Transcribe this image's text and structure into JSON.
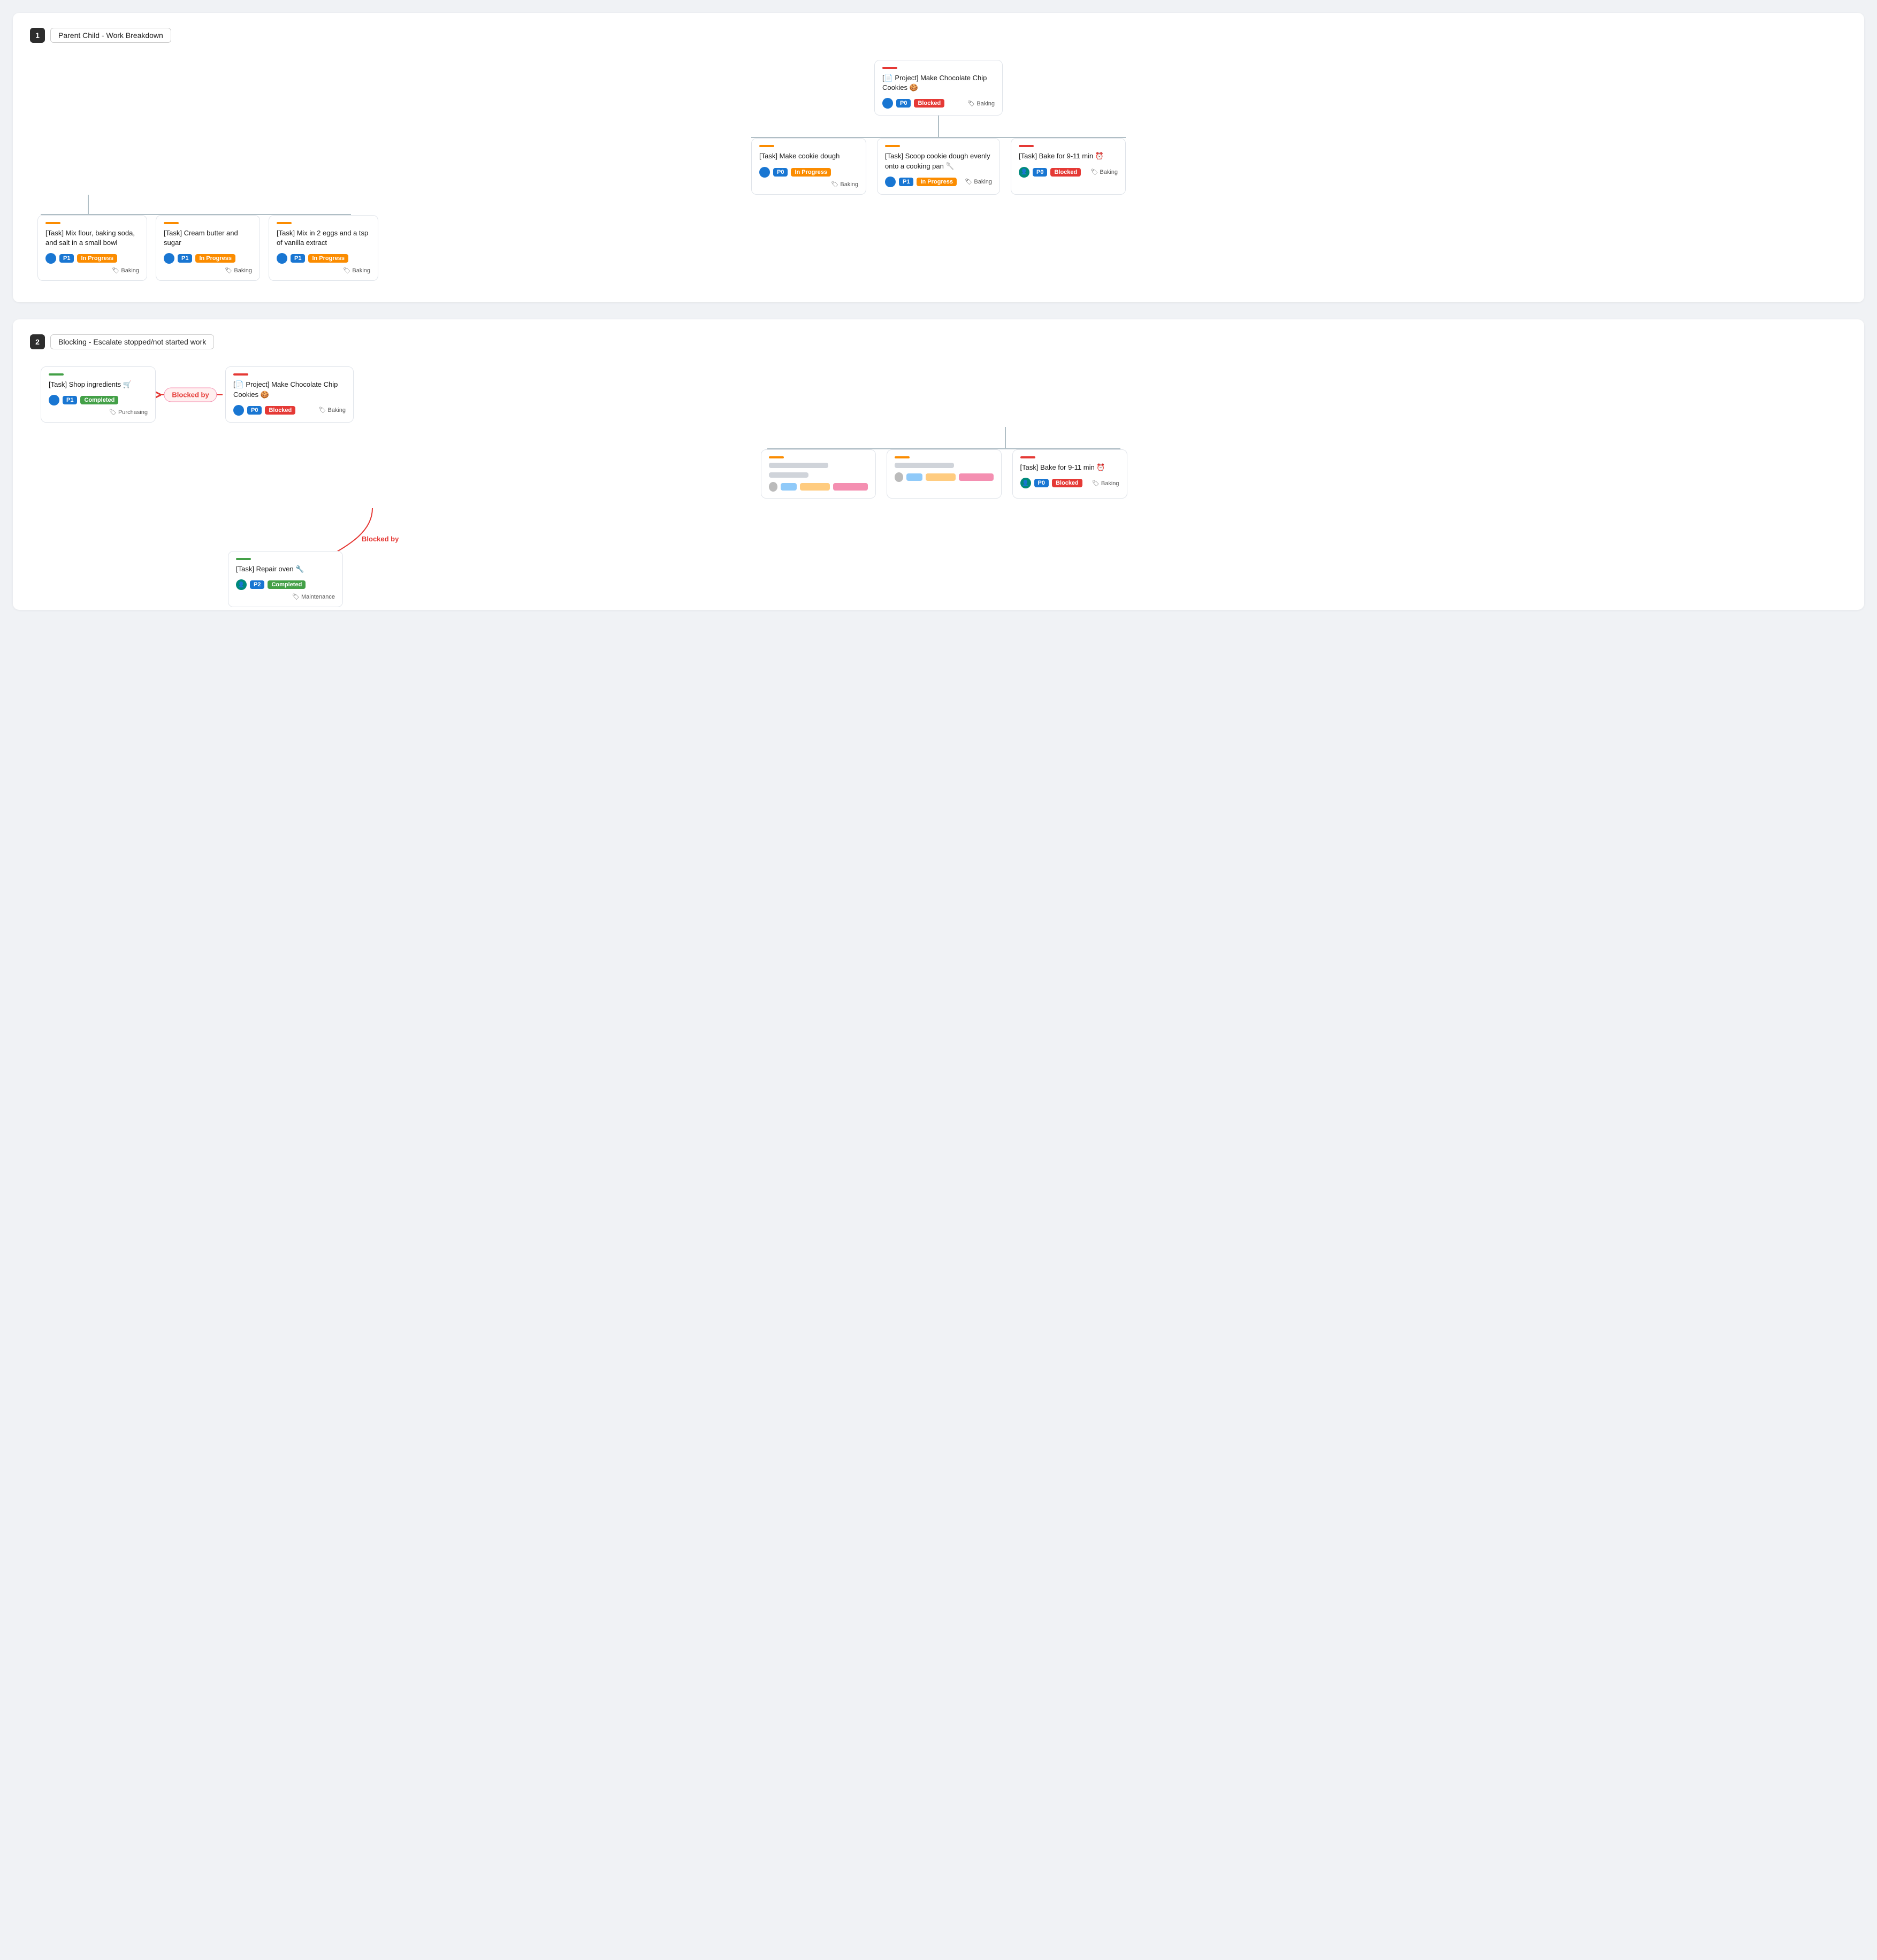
{
  "section1": {
    "num": "1",
    "title": "Parent Child - Work Breakdown",
    "root": {
      "bar": "bar-red",
      "title": "[📄 Project] Make Chocolate Chip Cookies 🍪",
      "avatar_color": "avatar-blue",
      "priority": "P0",
      "status": "Blocked",
      "status_class": "badge-blocked",
      "team": "🏷 Baking"
    },
    "level1": [
      {
        "bar": "bar-orange",
        "title": "[Task] Make cookie dough",
        "avatar_color": "avatar-blue",
        "priority": "P0",
        "status": "In Progress",
        "status_class": "badge-inprogress",
        "team": "🏷 Baking"
      },
      {
        "bar": "bar-orange",
        "title": "[Task] Scoop cookie dough evenly onto a cooking pan 🥄",
        "avatar_color": "avatar-blue",
        "priority": "P1",
        "status": "In Progress",
        "status_class": "badge-inprogress",
        "team": "🏷 Baking"
      },
      {
        "bar": "bar-red",
        "title": "[Task] Bake for 9-11 min ⏰",
        "avatar_color": "avatar-teal",
        "priority": "P0",
        "status": "Blocked",
        "status_class": "badge-blocked",
        "team": "🏷 Baking"
      }
    ],
    "level2": [
      {
        "bar": "bar-orange",
        "title": "[Task] Mix flour, baking soda, and salt in a small bowl",
        "avatar_color": "avatar-blue",
        "priority": "P1",
        "status": "In Progress",
        "status_class": "badge-inprogress",
        "team": "🏷 Baking"
      },
      {
        "bar": "bar-orange",
        "title": "[Task] Cream butter and sugar",
        "avatar_color": "avatar-blue",
        "priority": "P1",
        "status": "In Progress",
        "status_class": "badge-inprogress",
        "team": "🏷 Baking"
      },
      {
        "bar": "bar-orange",
        "title": "[Task] Mix in 2 eggs and a tsp of vanilla extract",
        "avatar_color": "avatar-blue",
        "priority": "P1",
        "status": "In Progress",
        "status_class": "badge-inprogress",
        "team": "🏷 Baking"
      }
    ]
  },
  "section2": {
    "num": "2",
    "title": "Blocking - Escalate stopped/not started work",
    "shop": {
      "bar": "bar-green",
      "title": "[Task] Shop ingredients 🛒",
      "avatar_color": "avatar-blue",
      "priority": "P1",
      "status": "Completed",
      "status_class": "badge-completed",
      "team": "🏷 Purchasing"
    },
    "blocked_by_label": "Blocked by",
    "root": {
      "bar": "bar-red",
      "title": "[📄 Project] Make Chocolate Chip Cookies 🍪",
      "avatar_color": "avatar-blue",
      "priority": "P0",
      "status": "Blocked",
      "status_class": "badge-blocked",
      "team": "🏷 Baking"
    },
    "bake": {
      "bar": "bar-red",
      "title": "[Task] Bake for 9-11 min ⏰",
      "avatar_color": "avatar-teal",
      "priority": "P0",
      "status": "Blocked",
      "status_class": "badge-blocked",
      "team": "🏷 Baking"
    },
    "repair": {
      "bar": "bar-green",
      "title": "[Task] Repair oven 🔧",
      "avatar_color": "avatar-teal",
      "priority": "P2",
      "status": "Completed",
      "status_class": "badge-completed",
      "team": "🏷 Maintenance"
    },
    "blocked_by_label2": "Blocked by"
  }
}
